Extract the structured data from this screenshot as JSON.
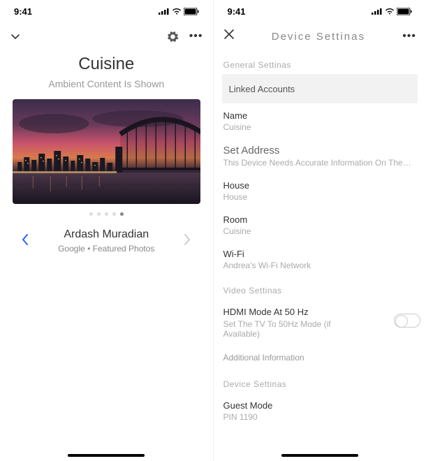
{
  "statusBar": {
    "time": "9:41"
  },
  "left": {
    "title": "Cuisine",
    "subtitle": "Ambient Content Is Shown",
    "artist": {
      "name": "Ardash Muradian",
      "source": "Google • Featured Photos"
    },
    "dots": {
      "count": 5,
      "activeIndex": 4
    }
  },
  "right": {
    "headerTitle": "Device Settinas",
    "sections": {
      "general": "General Settinas",
      "video": "Video Settinas",
      "device": "Device Settinas"
    },
    "linkedAccounts": "Linked Accounts",
    "name": {
      "label": "Name",
      "value": "Cuisine"
    },
    "address": {
      "label": "Set Address",
      "value": "This Device Needs Accurate Information On The…"
    },
    "house": {
      "label": "House",
      "value": "House"
    },
    "room": {
      "label": "Room",
      "value": "Cuisine"
    },
    "wifi": {
      "label": "Wi-Fi",
      "value": "Andrea's Wi-Fi Network"
    },
    "hdmi": {
      "label": "HDMI Mode At 50 Hz",
      "sub": "Set The TV To 50Hz Mode (if Available)"
    },
    "additional": "Additional Information",
    "guest": {
      "label": "Guest Mode",
      "value": "PIN 1190"
    }
  }
}
